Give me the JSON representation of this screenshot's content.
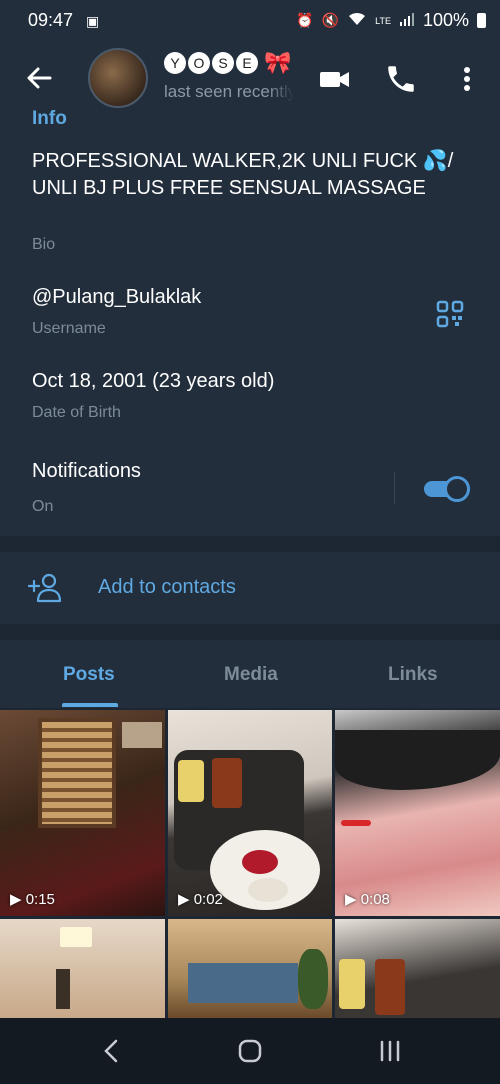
{
  "status": {
    "time": "09:47",
    "battery": "100%",
    "icons": [
      "calendar-icon",
      "alarm-icon",
      "mute-icon",
      "wifi-icon",
      "volte-icon",
      "signal-icon",
      "battery-icon"
    ]
  },
  "header": {
    "name_letters": [
      "Y",
      "O",
      "S",
      "E"
    ],
    "name_emoji": "🎀",
    "last_seen": "last seen recently"
  },
  "info": {
    "header": "Info",
    "bio": "PROFESSIONAL WALKER,2K UNLI FUCK 💦/ UNLI BJ PLUS FREE SENSUAL MASSAGE",
    "bio_label": "Bio",
    "username": "@Pulang_Bulaklak",
    "username_label": "Username",
    "dob": "Oct 18, 2001 (23 years old)",
    "dob_label": "Date of Birth",
    "notifications": "Notifications",
    "notifications_state": "On"
  },
  "contacts": {
    "add_label": "Add to contacts"
  },
  "tabs": [
    {
      "label": "Posts",
      "active": true
    },
    {
      "label": "Media"
    },
    {
      "label": "Links"
    }
  ],
  "posts": [
    {
      "duration": "0:15"
    },
    {
      "duration": "0:02"
    },
    {
      "duration": "0:08"
    },
    {
      "duration": ""
    },
    {
      "duration": ""
    },
    {
      "duration": ""
    }
  ],
  "colors": {
    "accent": "#5fa9e2",
    "background": "#1d2733",
    "surface": "#232e3c",
    "muted": "#7d8b99"
  }
}
